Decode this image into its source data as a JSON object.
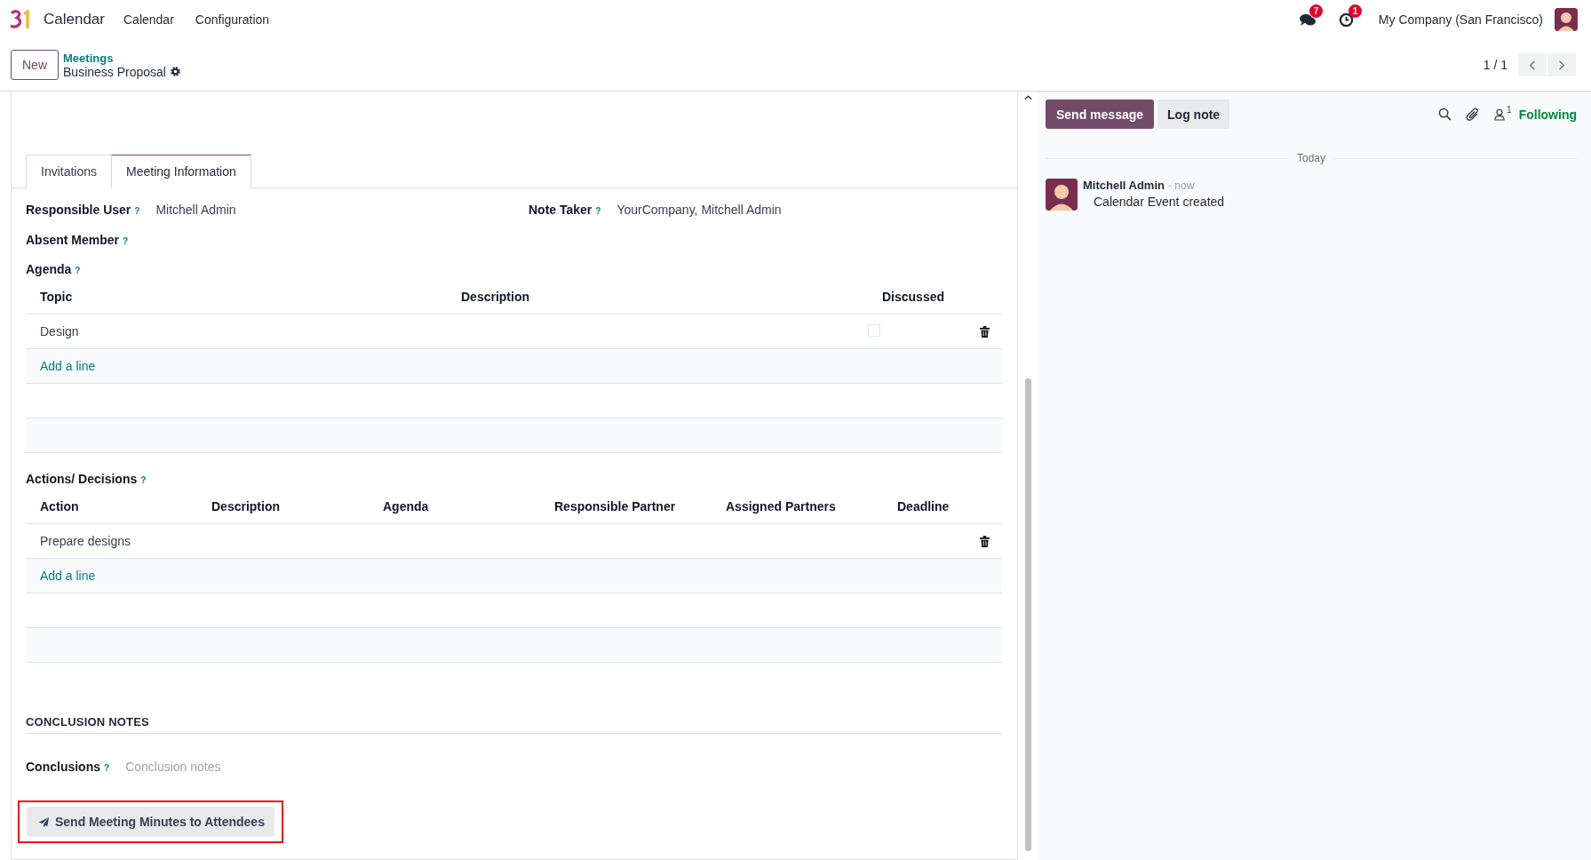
{
  "navbar": {
    "app_name": "Calendar",
    "menu": [
      "Calendar",
      "Configuration"
    ],
    "messages_badge": "7",
    "activities_badge": "1",
    "company": "My Company (San Francisco)"
  },
  "control_panel": {
    "new_button": "New",
    "breadcrumb": "Meetings",
    "record_title": "Business Proposal",
    "pager": "1 / 1"
  },
  "tabs": [
    {
      "label": "Invitations",
      "selected": false
    },
    {
      "label": "Meeting Information",
      "selected": true
    }
  ],
  "fields": [
    {
      "label": "Responsible User",
      "help": "?",
      "value": "Mitchell Admin"
    },
    {
      "label": "Note Taker",
      "help": "?",
      "value": "YourCompany, Mitchell Admin"
    }
  ],
  "absent_member": {
    "label": "Absent Member",
    "help": "?"
  },
  "agenda": {
    "label": "Agenda",
    "help": "?",
    "columns": [
      "Topic",
      "Description",
      "Discussed"
    ],
    "rows": [
      {
        "topic": "Design",
        "discussed": false
      }
    ],
    "add_line": "Add a line"
  },
  "actions": {
    "label": "Actions/ Decisions",
    "help": "?",
    "columns": [
      "Action",
      "Description",
      "Agenda",
      "Responsible Partner",
      "Assigned Partners",
      "Deadline"
    ],
    "rows": [
      {
        "action": "Prepare designs"
      }
    ],
    "add_line": "Add a line"
  },
  "conclusion": {
    "section_title": "CONCLUSION NOTES",
    "label": "Conclusions",
    "help": "?",
    "placeholder": "Conclusion notes"
  },
  "send_minutes_button": {
    "label": "Send Meeting Minutes to Attendees",
    "highlighted": true
  },
  "chatter": {
    "send_message": "Send message",
    "log_note": "Log note",
    "followers_count": "1",
    "following": "Following",
    "date_separator": "Today",
    "messages": [
      {
        "author": "Mitchell Admin",
        "time": "- now",
        "body": "Calendar Event created"
      }
    ]
  }
}
